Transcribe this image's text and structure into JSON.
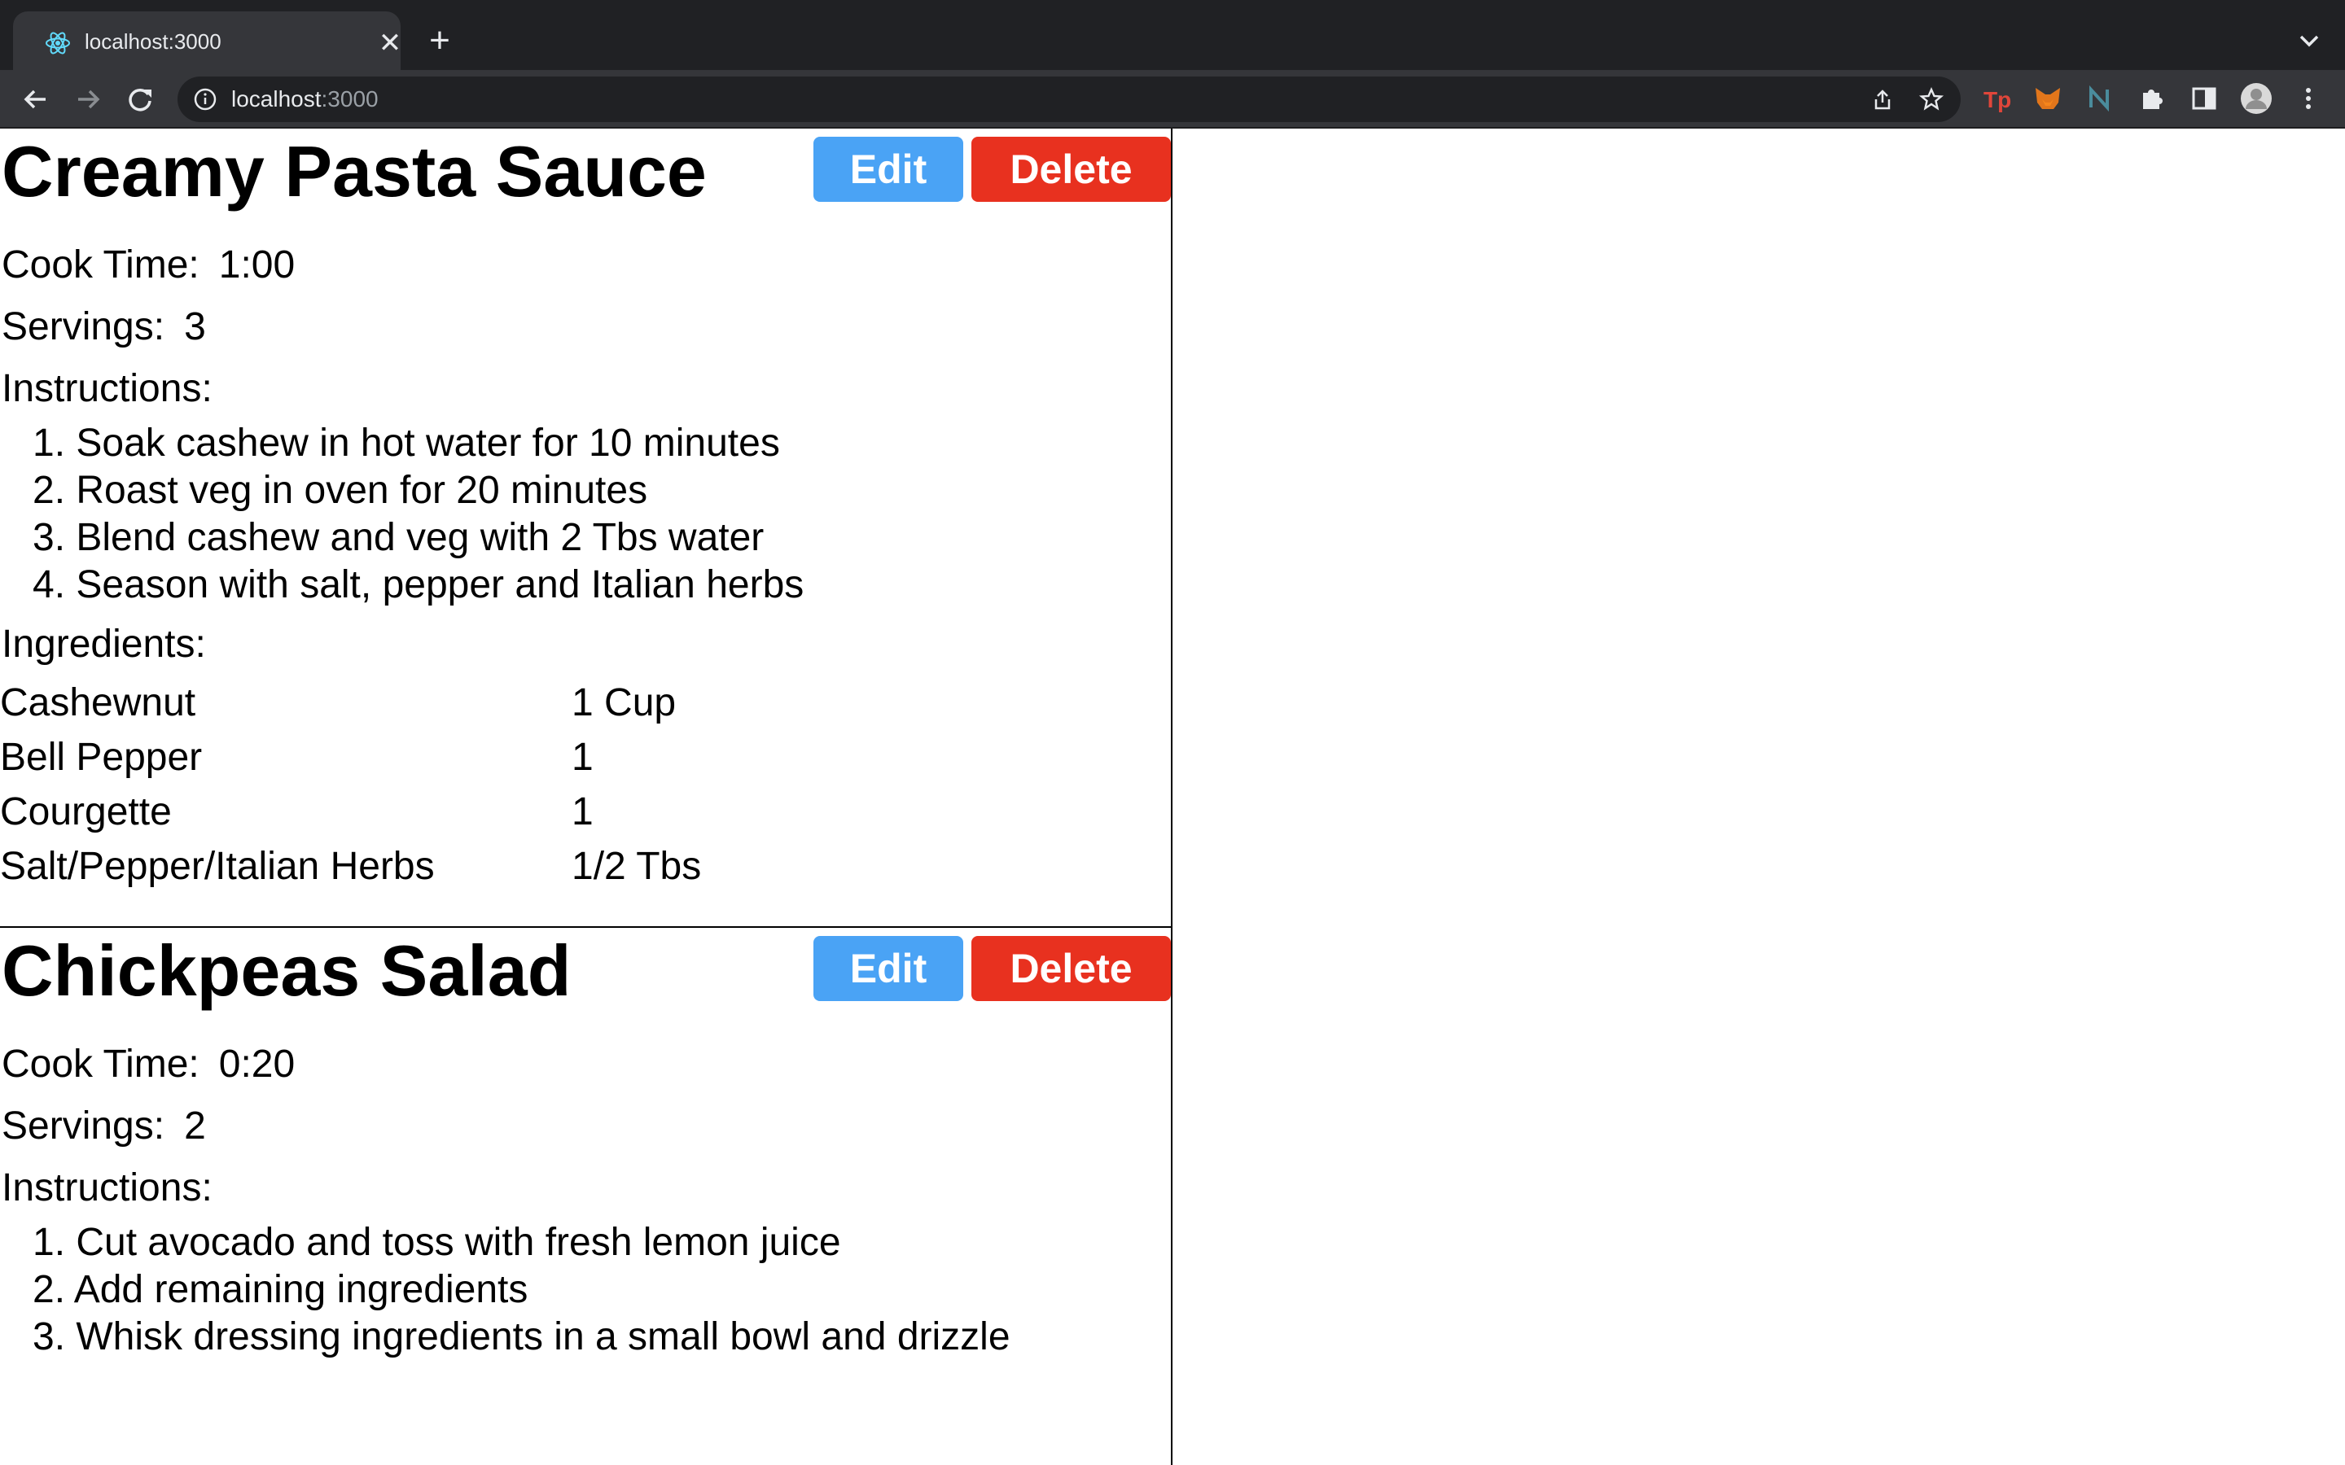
{
  "browser": {
    "tab": {
      "title": "localhost:3000"
    },
    "new_tab_label": "+",
    "close_label": "✕",
    "address": {
      "host": "localhost",
      "port": ":3000"
    },
    "colors": {
      "chrome_dark": "#202124",
      "chrome_tab": "#35363a"
    }
  },
  "recipes": [
    {
      "title": "Creamy Pasta Sauce",
      "edit_label": "Edit",
      "delete_label": "Delete",
      "cook_time_label": "Cook Time:",
      "cook_time": "1:00",
      "servings_label": "Servings:",
      "servings": "3",
      "instructions_label": "Instructions:",
      "instructions": [
        "1. Soak cashew in hot water for 10 minutes",
        "2. Roast veg in oven for 20 minutes",
        "3. Blend cashew and veg with 2 Tbs water",
        "4. Season with salt, pepper and Italian herbs"
      ],
      "ingredients_label": "Ingredients:",
      "ingredients": [
        {
          "name": "Cashewnut",
          "amount": "1 Cup"
        },
        {
          "name": "Bell Pepper",
          "amount": "1"
        },
        {
          "name": "Courgette",
          "amount": "1"
        },
        {
          "name": "Salt/Pepper/Italian Herbs",
          "amount": "1/2 Tbs"
        }
      ]
    },
    {
      "title": "Chickpeas Salad",
      "edit_label": "Edit",
      "delete_label": "Delete",
      "cook_time_label": "Cook Time:",
      "cook_time": "0:20",
      "servings_label": "Servings:",
      "servings": "2",
      "instructions_label": "Instructions:",
      "instructions": [
        "1. Cut avocado and toss with fresh lemon juice",
        "2. Add remaining ingredients",
        "3. Whisk dressing ingredients in a small bowl and drizzle"
      ]
    }
  ],
  "colors": {
    "edit": "#4aa3f5",
    "delete": "#e8311f"
  }
}
